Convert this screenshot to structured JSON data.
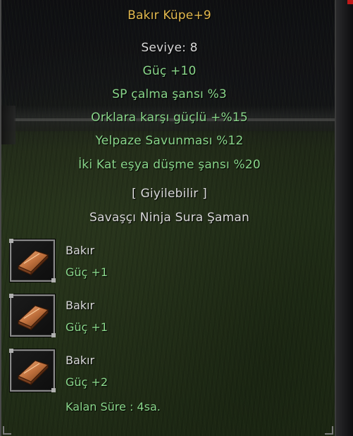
{
  "tooltip": {
    "title": "Bakır Küpe+9",
    "level": "Seviye: 8",
    "stats": [
      "Güç +10",
      "SP çalma şansı %3",
      "Orklara karşı güçlü +%15",
      "Yelpaze Savunması %12",
      "İki Kat eşya düşme şansı %20"
    ],
    "wearable": "[ Giyilebilir ]",
    "classes": "Savaşçı Ninja Sura Şaman",
    "sockets": [
      {
        "icon": "copper-ingot-icon",
        "name": "Bakır",
        "bonus": "Güç +1"
      },
      {
        "icon": "copper-ingot-icon",
        "name": "Bakır",
        "bonus": "Güç +1"
      },
      {
        "icon": "copper-ingot-icon",
        "name": "Bakır",
        "bonus": "Güç +2"
      }
    ],
    "time_left": "Kalan Süre : 4sa."
  },
  "colors": {
    "title": "#e3b94e",
    "white_text": "#d8d8d8",
    "green_text": "#89d68a",
    "copper": "#c0703c"
  }
}
